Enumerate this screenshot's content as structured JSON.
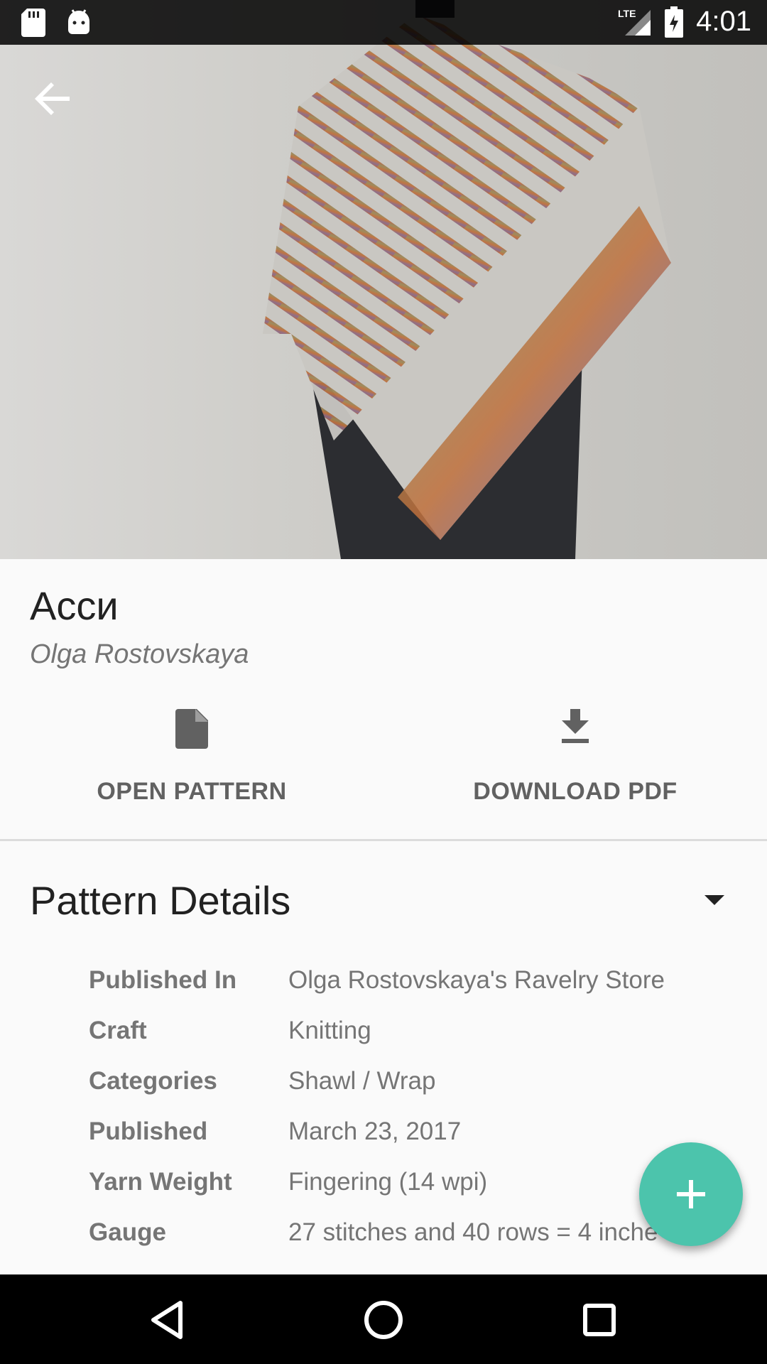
{
  "status_bar": {
    "time": "4:01",
    "network_label": "LTE",
    "icons": [
      "sd-card-icon",
      "android-icon",
      "lte-signal-icon",
      "battery-icon"
    ]
  },
  "hero": {
    "image_subject": "knitted-shawl-photo"
  },
  "pattern": {
    "title": "Асси",
    "author": "Olga Rostovskaya"
  },
  "actions": {
    "open_label": "OPEN PATTERN",
    "download_label": "DOWNLOAD PDF"
  },
  "details": {
    "section_title": "Pattern Details",
    "rows": [
      {
        "label": "Published In",
        "value": "Olga Rostovskaya's Ravelry Store"
      },
      {
        "label": "Craft",
        "value": "Knitting"
      },
      {
        "label": "Categories",
        "value": "Shawl / Wrap"
      },
      {
        "label": "Published",
        "value": "March 23, 2017"
      },
      {
        "label": "Yarn Weight",
        "value": "Fingering (14 wpi)"
      },
      {
        "label": "Gauge",
        "value": "27 stitches and 40 rows = 4 inche"
      }
    ]
  },
  "colors": {
    "fab": "#4cc4ac",
    "text_primary": "#212121",
    "text_secondary": "#757575"
  }
}
